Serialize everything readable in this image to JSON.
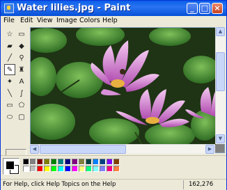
{
  "window": {
    "title": "Water lilies.jpg - Paint"
  },
  "menu": [
    "File",
    "Edit",
    "View",
    "Image",
    "Colors",
    "Help"
  ],
  "tools": [
    {
      "name": "free-form-select-icon",
      "glyph": "☆"
    },
    {
      "name": "select-icon",
      "glyph": "▭"
    },
    {
      "name": "eraser-icon",
      "glyph": "▰"
    },
    {
      "name": "fill-bucket-icon",
      "glyph": "◆"
    },
    {
      "name": "color-picker-icon",
      "glyph": "╱"
    },
    {
      "name": "magnifier-icon",
      "glyph": "⚲"
    },
    {
      "name": "pencil-icon",
      "glyph": "✎"
    },
    {
      "name": "brush-icon",
      "glyph": "♜"
    },
    {
      "name": "airbrush-icon",
      "glyph": "✦"
    },
    {
      "name": "text-icon",
      "glyph": "A"
    },
    {
      "name": "line-icon",
      "glyph": "╲"
    },
    {
      "name": "curve-icon",
      "glyph": "∫"
    },
    {
      "name": "rectangle-icon",
      "glyph": "▭"
    },
    {
      "name": "polygon-icon",
      "glyph": "⬠"
    },
    {
      "name": "ellipse-icon",
      "glyph": "⬭"
    },
    {
      "name": "rounded-rectangle-icon",
      "glyph": "▢"
    }
  ],
  "palette": {
    "foreground": "#000000",
    "background": "#ffffff",
    "top_row": [
      "#000000",
      "#808080",
      "#800000",
      "#808000",
      "#008000",
      "#008080",
      "#000080",
      "#800080",
      "#808040",
      "#004040",
      "#0080ff",
      "#004080",
      "#8000ff",
      "#804000"
    ],
    "bottom_row": [
      "#ffffff",
      "#c0c0c0",
      "#ff0000",
      "#ffff00",
      "#00ff00",
      "#00ffff",
      "#0000ff",
      "#ff00ff",
      "#ffff80",
      "#00ff80",
      "#80ffff",
      "#8080ff",
      "#ff0080",
      "#ff8040"
    ]
  },
  "status": {
    "text": "For Help, click Help Topics on the Help",
    "coords": "162,276"
  },
  "image": {
    "subject": "water-lilies-photo"
  }
}
